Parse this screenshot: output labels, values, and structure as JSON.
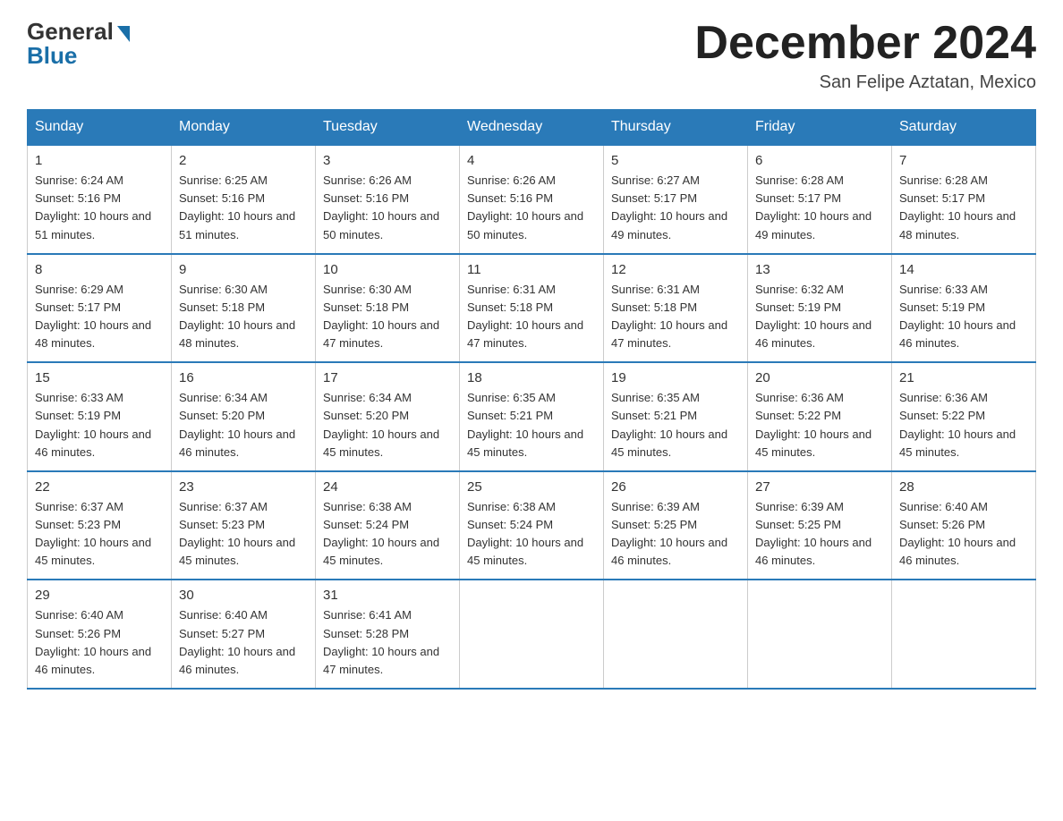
{
  "header": {
    "logo_general": "General",
    "logo_blue": "Blue",
    "month_title": "December 2024",
    "location": "San Felipe Aztatan, Mexico"
  },
  "days_of_week": [
    "Sunday",
    "Monday",
    "Tuesday",
    "Wednesday",
    "Thursday",
    "Friday",
    "Saturday"
  ],
  "weeks": [
    [
      {
        "day": "1",
        "sunrise": "6:24 AM",
        "sunset": "5:16 PM",
        "daylight": "10 hours and 51 minutes."
      },
      {
        "day": "2",
        "sunrise": "6:25 AM",
        "sunset": "5:16 PM",
        "daylight": "10 hours and 51 minutes."
      },
      {
        "day": "3",
        "sunrise": "6:26 AM",
        "sunset": "5:16 PM",
        "daylight": "10 hours and 50 minutes."
      },
      {
        "day": "4",
        "sunrise": "6:26 AM",
        "sunset": "5:16 PM",
        "daylight": "10 hours and 50 minutes."
      },
      {
        "day": "5",
        "sunrise": "6:27 AM",
        "sunset": "5:17 PM",
        "daylight": "10 hours and 49 minutes."
      },
      {
        "day": "6",
        "sunrise": "6:28 AM",
        "sunset": "5:17 PM",
        "daylight": "10 hours and 49 minutes."
      },
      {
        "day": "7",
        "sunrise": "6:28 AM",
        "sunset": "5:17 PM",
        "daylight": "10 hours and 48 minutes."
      }
    ],
    [
      {
        "day": "8",
        "sunrise": "6:29 AM",
        "sunset": "5:17 PM",
        "daylight": "10 hours and 48 minutes."
      },
      {
        "day": "9",
        "sunrise": "6:30 AM",
        "sunset": "5:18 PM",
        "daylight": "10 hours and 48 minutes."
      },
      {
        "day": "10",
        "sunrise": "6:30 AM",
        "sunset": "5:18 PM",
        "daylight": "10 hours and 47 minutes."
      },
      {
        "day": "11",
        "sunrise": "6:31 AM",
        "sunset": "5:18 PM",
        "daylight": "10 hours and 47 minutes."
      },
      {
        "day": "12",
        "sunrise": "6:31 AM",
        "sunset": "5:18 PM",
        "daylight": "10 hours and 47 minutes."
      },
      {
        "day": "13",
        "sunrise": "6:32 AM",
        "sunset": "5:19 PM",
        "daylight": "10 hours and 46 minutes."
      },
      {
        "day": "14",
        "sunrise": "6:33 AM",
        "sunset": "5:19 PM",
        "daylight": "10 hours and 46 minutes."
      }
    ],
    [
      {
        "day": "15",
        "sunrise": "6:33 AM",
        "sunset": "5:19 PM",
        "daylight": "10 hours and 46 minutes."
      },
      {
        "day": "16",
        "sunrise": "6:34 AM",
        "sunset": "5:20 PM",
        "daylight": "10 hours and 46 minutes."
      },
      {
        "day": "17",
        "sunrise": "6:34 AM",
        "sunset": "5:20 PM",
        "daylight": "10 hours and 45 minutes."
      },
      {
        "day": "18",
        "sunrise": "6:35 AM",
        "sunset": "5:21 PM",
        "daylight": "10 hours and 45 minutes."
      },
      {
        "day": "19",
        "sunrise": "6:35 AM",
        "sunset": "5:21 PM",
        "daylight": "10 hours and 45 minutes."
      },
      {
        "day": "20",
        "sunrise": "6:36 AM",
        "sunset": "5:22 PM",
        "daylight": "10 hours and 45 minutes."
      },
      {
        "day": "21",
        "sunrise": "6:36 AM",
        "sunset": "5:22 PM",
        "daylight": "10 hours and 45 minutes."
      }
    ],
    [
      {
        "day": "22",
        "sunrise": "6:37 AM",
        "sunset": "5:23 PM",
        "daylight": "10 hours and 45 minutes."
      },
      {
        "day": "23",
        "sunrise": "6:37 AM",
        "sunset": "5:23 PM",
        "daylight": "10 hours and 45 minutes."
      },
      {
        "day": "24",
        "sunrise": "6:38 AM",
        "sunset": "5:24 PM",
        "daylight": "10 hours and 45 minutes."
      },
      {
        "day": "25",
        "sunrise": "6:38 AM",
        "sunset": "5:24 PM",
        "daylight": "10 hours and 45 minutes."
      },
      {
        "day": "26",
        "sunrise": "6:39 AM",
        "sunset": "5:25 PM",
        "daylight": "10 hours and 46 minutes."
      },
      {
        "day": "27",
        "sunrise": "6:39 AM",
        "sunset": "5:25 PM",
        "daylight": "10 hours and 46 minutes."
      },
      {
        "day": "28",
        "sunrise": "6:40 AM",
        "sunset": "5:26 PM",
        "daylight": "10 hours and 46 minutes."
      }
    ],
    [
      {
        "day": "29",
        "sunrise": "6:40 AM",
        "sunset": "5:26 PM",
        "daylight": "10 hours and 46 minutes."
      },
      {
        "day": "30",
        "sunrise": "6:40 AM",
        "sunset": "5:27 PM",
        "daylight": "10 hours and 46 minutes."
      },
      {
        "day": "31",
        "sunrise": "6:41 AM",
        "sunset": "5:28 PM",
        "daylight": "10 hours and 47 minutes."
      },
      null,
      null,
      null,
      null
    ]
  ]
}
